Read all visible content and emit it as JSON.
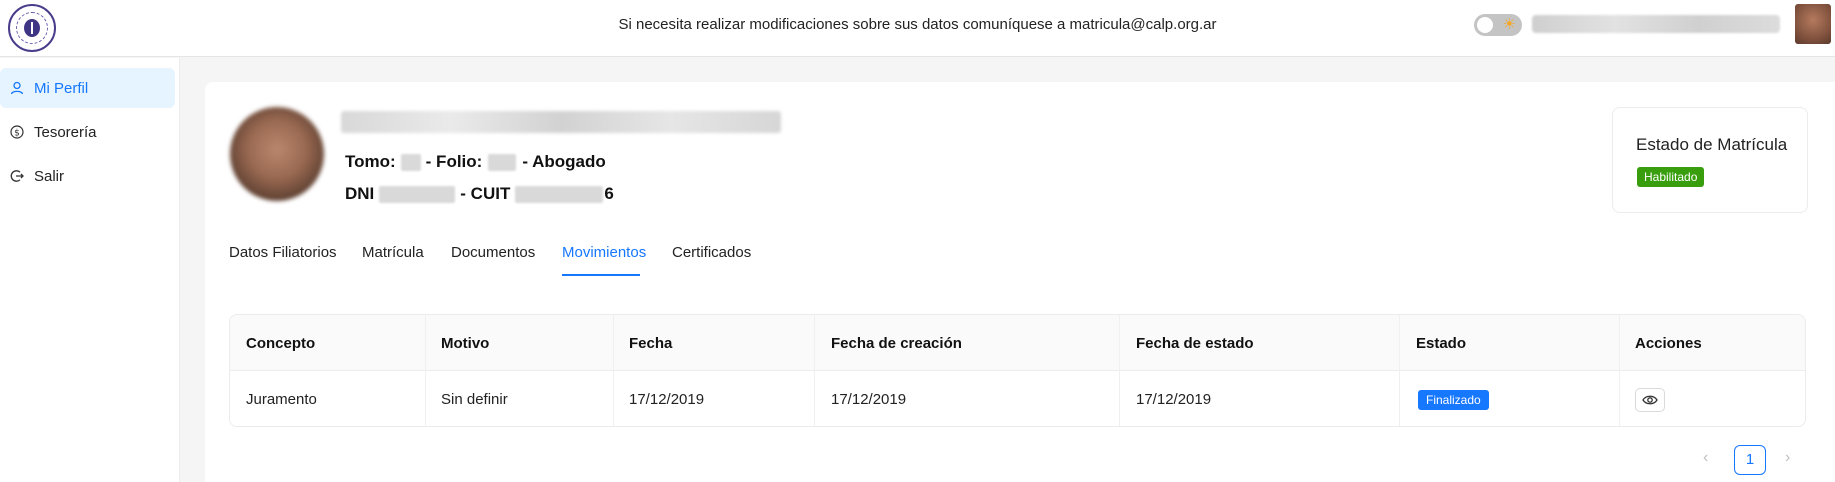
{
  "header": {
    "notice": "Si necesita realizar modificaciones sobre sus datos comuníquese a matricula@calp.org.ar",
    "theme_toggle_icon": "sun-icon"
  },
  "sidebar": {
    "items": [
      {
        "label": "Mi Perfil",
        "icon": "user-icon",
        "active": true
      },
      {
        "label": "Tesorería",
        "icon": "dollar-icon",
        "active": false
      },
      {
        "label": "Salir",
        "icon": "logout-icon",
        "active": false
      }
    ]
  },
  "profile": {
    "tomo_label": "Tomo:",
    "folio_label": "- Folio:",
    "role": "- Abogado",
    "dni_label": "DNI",
    "cuit_label": "- CUIT",
    "cuit_suffix": "6"
  },
  "status": {
    "title": "Estado de Matrícula",
    "badge": "Habilitado",
    "badge_color": "#389e0d"
  },
  "tabs": [
    {
      "label": "Datos Filiatorios"
    },
    {
      "label": "Matrícula"
    },
    {
      "label": "Documentos"
    },
    {
      "label": "Movimientos",
      "active": true
    },
    {
      "label": "Certificados"
    }
  ],
  "table": {
    "columns": [
      "Concepto",
      "Motivo",
      "Fecha",
      "Fecha de creación",
      "Fecha de estado",
      "Estado",
      "Acciones"
    ],
    "rows": [
      {
        "concepto": "Juramento",
        "motivo": "Sin definir",
        "fecha": "17/12/2019",
        "fecha_creacion": "17/12/2019",
        "fecha_estado": "17/12/2019",
        "estado": "Finalizado",
        "accion_icon": "eye-icon"
      }
    ]
  },
  "pagination": {
    "prev": "‹",
    "current": "1",
    "next": "›"
  },
  "colors": {
    "accent": "#1677ff",
    "success": "#389e0d"
  }
}
